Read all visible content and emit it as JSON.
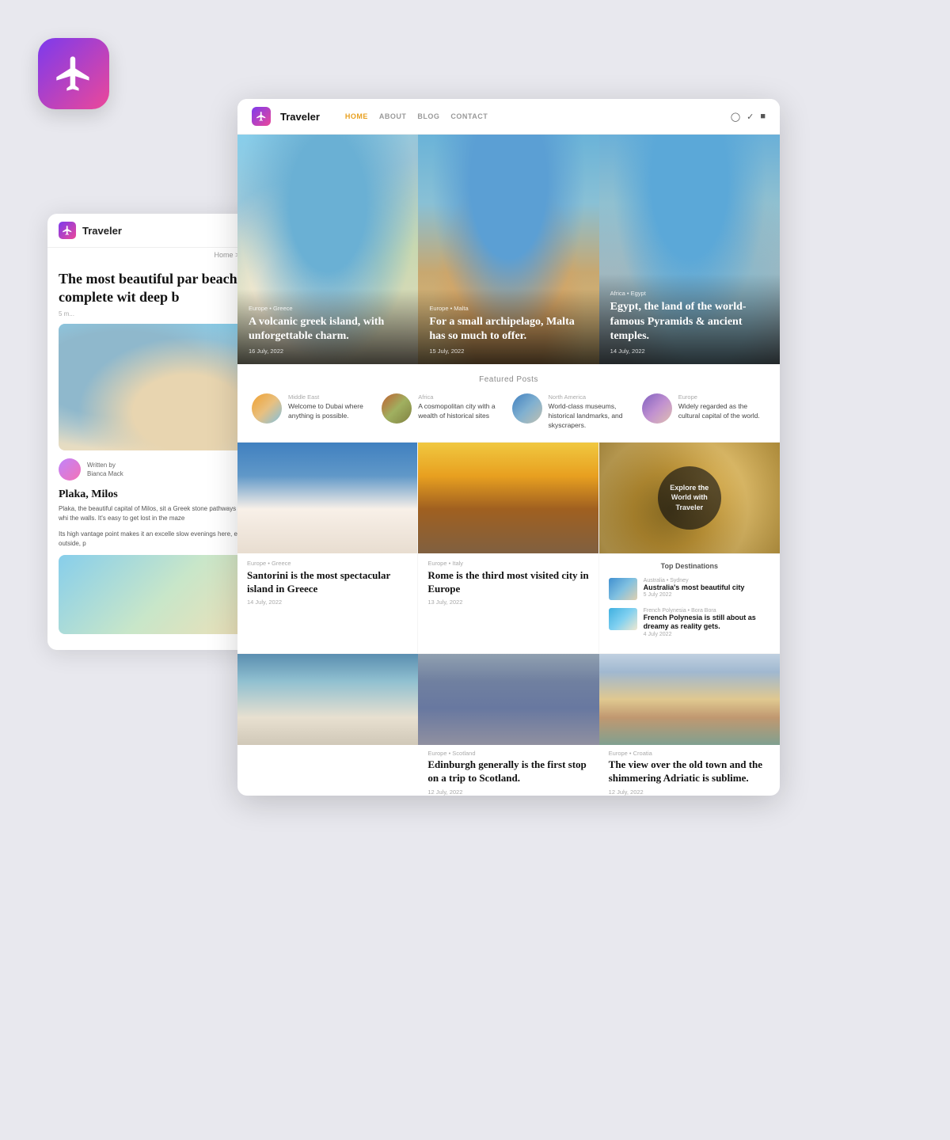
{
  "appIcon": {
    "label": "Traveler App Icon"
  },
  "nav": {
    "brand": "Traveler",
    "links": [
      {
        "label": "HOME",
        "active": true
      },
      {
        "label": "ABOUT",
        "active": false
      },
      {
        "label": "BLOG",
        "active": false
      },
      {
        "label": "CONTACT",
        "active": false
      }
    ],
    "socialIcons": [
      "instagram-icon",
      "twitter-icon",
      "facebook-icon"
    ]
  },
  "hero": {
    "cards": [
      {
        "category": "Europe • Greece",
        "title": "A volcanic greek island, with unforgettable charm.",
        "date": "16 July, 2022"
      },
      {
        "category": "Europe • Malta",
        "title": "For a small archipelago, Malta has so much to offer.",
        "date": "15 July, 2022"
      },
      {
        "category": "Africa • Egypt",
        "title": "Egypt, the land of the world-famous Pyramids & ancient temples.",
        "date": "14 July, 2022"
      }
    ]
  },
  "featuredSection": {
    "title": "Featured Posts",
    "items": [
      {
        "region": "Middle East",
        "description": "Welcome to Dubai where anything is possible."
      },
      {
        "region": "Africa",
        "description": "A cosmopolitan city with a wealth of historical sites"
      },
      {
        "region": "North America",
        "description": "World-class museums, historical landmarks, and skyscrapers."
      },
      {
        "region": "Europe",
        "description": "Widely regarded as the cultural capital of the world."
      }
    ]
  },
  "posts": [
    {
      "region": "Europe • Greece",
      "title": "Santorini is the most spectacular island in Greece",
      "date": "14 July, 2022"
    },
    {
      "region": "Europe • Italy",
      "title": "Rome is the third most visited city in Europe",
      "date": "13 July, 2022"
    },
    {
      "explore": {
        "text": "Explore the World with Traveler"
      }
    }
  ],
  "topDestinations": {
    "title": "Top Destinations",
    "items": [
      {
        "region": "Australia • Sydney",
        "title": "Australia's most beautiful city",
        "date": "5 July 2022"
      },
      {
        "region": "French Polynesia • Bora Bora",
        "title": "French Polynesia is still about as dreamy as reality gets.",
        "date": "4 July 2022"
      }
    ]
  },
  "bottomPosts": [
    {
      "region": "Europe • Scotland",
      "title": "Edinburgh generally is the first stop on a trip to Scotland.",
      "date": "12 July, 2022"
    },
    {
      "region": "Europe • Croatia",
      "title": "The view over the old town and the shimmering Adriatic is sublime.",
      "date": "12 July, 2022"
    }
  ],
  "bgCard": {
    "brand": "Traveler",
    "breadcrumb": "Home > Blog > A...",
    "headline": "The most beautiful par beaches, complete wit deep b",
    "meta": "5 m...",
    "sectionTitle": "Plaka, Milos",
    "bodyText": "Plaka, the beautiful capital of Milos, sit a Greek stone pathways laid between whi the walls. It's easy to get lost in the maze",
    "bodyText2": "Its high vantage point makes it an excelle slow evenings here, eating food outside, p"
  }
}
